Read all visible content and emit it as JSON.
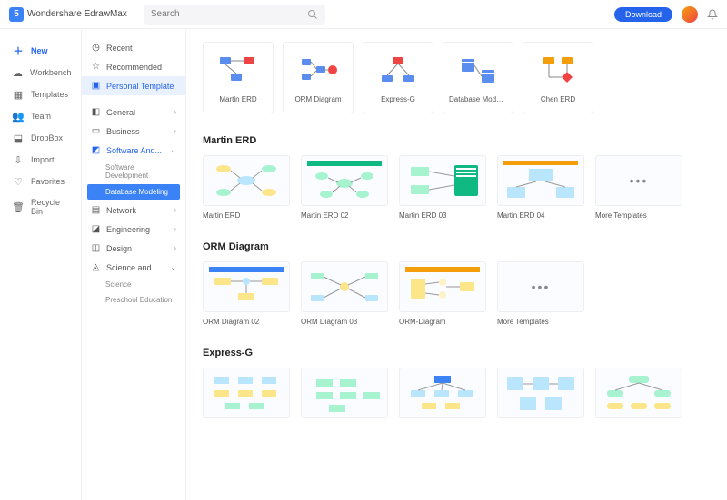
{
  "app": {
    "name": "Wondershare EdrawMax",
    "logo_letter": "5"
  },
  "header": {
    "search_placeholder": "Search",
    "download_label": "Download"
  },
  "sidebar": {
    "items": [
      {
        "label": "New",
        "icon": "plus"
      },
      {
        "label": "Workbench",
        "icon": "cloud"
      },
      {
        "label": "Templates",
        "icon": "grid"
      },
      {
        "label": "Team",
        "icon": "users"
      },
      {
        "label": "DropBox",
        "icon": "box"
      },
      {
        "label": "Import",
        "icon": "import"
      },
      {
        "label": "Favorites",
        "icon": "heart"
      },
      {
        "label": "Recycle Bin",
        "icon": "trash"
      }
    ]
  },
  "nav": {
    "top": [
      {
        "label": "Recent",
        "icon": "clock"
      },
      {
        "label": "Recommended",
        "icon": "star"
      },
      {
        "label": "Personal Template",
        "icon": "folder"
      }
    ],
    "cats": [
      {
        "label": "General",
        "icon": "doc"
      },
      {
        "label": "Business",
        "icon": "brief"
      },
      {
        "label": "Software And...",
        "icon": "sw",
        "expanded": true,
        "subs": [
          "Software Development",
          "Database Modeling"
        ]
      },
      {
        "label": "Network",
        "icon": "net"
      },
      {
        "label": "Engineering",
        "icon": "eng"
      },
      {
        "label": "Design",
        "icon": "des"
      },
      {
        "label": "Science and ...",
        "icon": "sci",
        "expanded": true,
        "subs": [
          "Science",
          "Preschool Education"
        ]
      }
    ]
  },
  "categories_row": [
    {
      "label": "Martin ERD"
    },
    {
      "label": "ORM Diagram"
    },
    {
      "label": "Express-G"
    },
    {
      "label": "Database Model Di..."
    },
    {
      "label": "Chen ERD"
    }
  ],
  "sections": [
    {
      "title": "Martin ERD",
      "items": [
        {
          "label": "Martin ERD"
        },
        {
          "label": "Martin ERD 02"
        },
        {
          "label": "Martin ERD 03"
        },
        {
          "label": "Martin ERD 04"
        },
        {
          "label": "More Templates",
          "more": true
        }
      ]
    },
    {
      "title": "ORM Diagram",
      "items": [
        {
          "label": "ORM Diagram 02"
        },
        {
          "label": "ORM Diagram 03"
        },
        {
          "label": "ORM-Diagram"
        },
        {
          "label": "More Templates",
          "more": true
        }
      ]
    },
    {
      "title": "Express-G",
      "items": [
        {
          "label": ""
        },
        {
          "label": ""
        },
        {
          "label": ""
        },
        {
          "label": ""
        },
        {
          "label": ""
        }
      ]
    }
  ]
}
